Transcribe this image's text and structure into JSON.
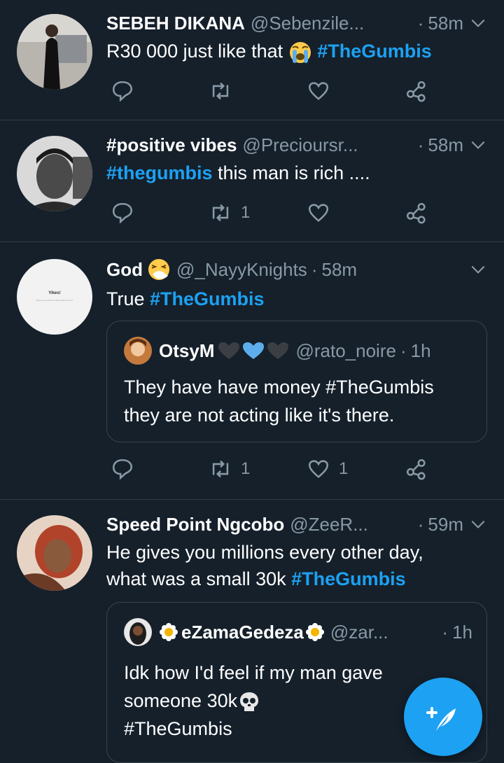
{
  "colors": {
    "background": "#15202b",
    "accent": "#1da1f2",
    "muted": "#8899a6",
    "divider": "#2f3d4a"
  },
  "tweets": [
    {
      "name": "SEBEH DIKANA",
      "handle": "@Sebenzile...",
      "time": "58m",
      "text_1": "R30 000 just like that",
      "emoji": "crying-face",
      "tag": "#TheGumbis",
      "retweets": "",
      "likes": ""
    },
    {
      "name": "#positive vibes",
      "handle": "@Precioursr...",
      "time": "58m",
      "tag": "#thegumbis",
      "text_1": " this man is rich ....",
      "retweets": "1",
      "likes": ""
    },
    {
      "name": "God",
      "emoji": "sneezing-face",
      "handle": "@_NayyKnights",
      "time": "58m",
      "text_1": "True ",
      "tag": "#TheGumbis",
      "avatar_title": "Yikes!",
      "avatar_subtitle": "There are no GIFs for that search. Hmm.",
      "quote": {
        "name": "OtsyM",
        "handle": "@rato_noire",
        "time": "1h",
        "line_1": "They have have money #TheGumbis",
        "line_2": "they are not acting like it's there."
      },
      "retweets": "1",
      "likes": "1"
    },
    {
      "name": "Speed Point Ngcobo",
      "handle": "@ZeeR...",
      "time": "59m",
      "line_1": "He gives you millions every other day,",
      "line_2": "what was a small 30k ",
      "tag": "#TheGumbis",
      "quote": {
        "name": "eZamaGedeza",
        "handle": "@zar...",
        "time": "1h",
        "line_1": "Idk how I'd feel if my man gave",
        "line_2": "someone 30k",
        "line_3": "#TheGumbis"
      }
    }
  ],
  "dot": "·",
  "compose_icon": "compose-tweet-icon"
}
